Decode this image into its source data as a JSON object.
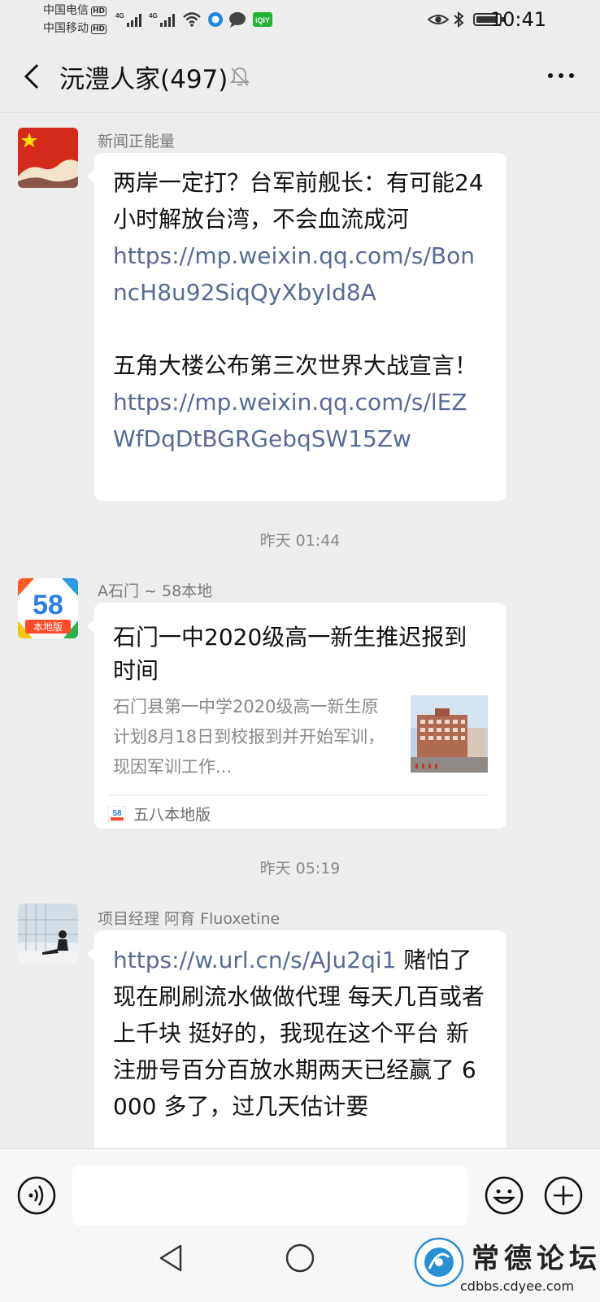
{
  "status": {
    "carrier1": "中国电信",
    "carrier2": "中国移动",
    "hd": "HD",
    "net": "4G",
    "time": "10:41"
  },
  "header": {
    "title": "沅澧人家(497)"
  },
  "messages": [
    {
      "sender": "新闻正能量",
      "text1": "两岸一定打？台军前舰长：有可能24 小时解放台湾，不会血流成河",
      "link1": "https://mp.weixin.qq.com/s/BonncH8u92SiqQyXbyId8A",
      "text2": "五角大楼公布第三次世界大战宣言！",
      "link2": "https://mp.weixin.qq.com/s/lEZWfDqDtBGRGebqSW15Zw"
    },
    {
      "time": "昨天 01:44",
      "sender": "A石门 ~ 58本地",
      "avatar_text": "58",
      "avatar_sub": "本地版",
      "card_title": "石门一中2020级高一新生推迟报到时间",
      "card_desc": "石门县第一中学2020级高一新生原计划8月18日到校报到并开始军训，现因军训工作...",
      "card_source": "五八本地版"
    },
    {
      "time": "昨天 05:19",
      "sender": "项目经理 阿育 Fluoxetine",
      "link": "https://w.url.cn/s/AJu2qi1",
      "text": " 赌怕了 现在刷刷流水做做代理 每天几百或者上千块 挺好的，我现在这个平台 新注册号百分百放水期两天已经赢了 6000 多了，过几天估计要"
    }
  ],
  "watermark": {
    "name": "常德论坛",
    "url": "cdbbs.cdyee.com"
  },
  "colors": {
    "background": "#ededed",
    "link": "#576b95",
    "bubble": "#ffffff"
  }
}
